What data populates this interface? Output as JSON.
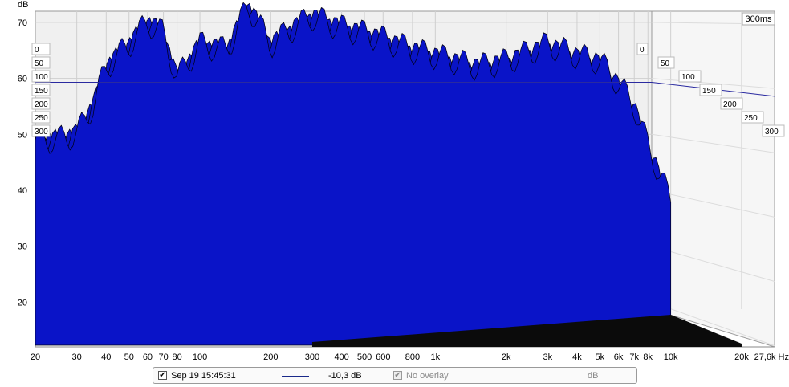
{
  "chart_data": {
    "type": "area",
    "chart_kind": "cumulative spectral decay (waterfall)",
    "ylabel": "dB",
    "xunit": "Hz",
    "yticks": [
      "70",
      "60",
      "50",
      "40",
      "30",
      "20"
    ],
    "xticks": [
      {
        "f": 20,
        "label": "20"
      },
      {
        "f": 30,
        "label": "30"
      },
      {
        "f": 40,
        "label": "40"
      },
      {
        "f": 50,
        "label": "50"
      },
      {
        "f": 60,
        "label": "60"
      },
      {
        "f": 70,
        "label": "70"
      },
      {
        "f": 80,
        "label": "80"
      },
      {
        "f": 100,
        "label": "100"
      },
      {
        "f": 200,
        "label": "200"
      },
      {
        "f": 300,
        "label": "300"
      },
      {
        "f": 400,
        "label": "400"
      },
      {
        "f": 500,
        "label": "500"
      },
      {
        "f": 600,
        "label": "600"
      },
      {
        "f": 800,
        "label": "800"
      },
      {
        "f": 1000,
        "label": "1k"
      },
      {
        "f": 2000,
        "label": "2k"
      },
      {
        "f": 3000,
        "label": "3k"
      },
      {
        "f": 4000,
        "label": "4k"
      },
      {
        "f": 5000,
        "label": "5k"
      },
      {
        "f": 6000,
        "label": "6k"
      },
      {
        "f": 7000,
        "label": "7k"
      },
      {
        "f": 8000,
        "label": "8k"
      },
      {
        "f": 10000,
        "label": "10k"
      },
      {
        "f": 20000,
        "label": "20k"
      },
      {
        "f": 27600,
        "label": "27,6k Hz"
      }
    ],
    "xscale": "log",
    "xlim": [
      20,
      27600
    ],
    "ylim": [
      12,
      72
    ],
    "time_axis_label": "300ms",
    "time_ticks": [
      "0",
      "50",
      "100",
      "150",
      "200",
      "250",
      "300"
    ],
    "time_range_ms": [
      0,
      300
    ],
    "series": [
      {
        "color": "#0a14c8",
        "frequency_hz": [
          20,
          25,
          30,
          35,
          40,
          50,
          60,
          70,
          80,
          100,
          130,
          160,
          200,
          250,
          300,
          400,
          500,
          600,
          800,
          1000,
          1500,
          2000,
          3000,
          4000,
          5000,
          6000,
          7000,
          8000,
          10000
        ],
        "level_db": [
          49,
          49,
          50,
          55,
          62,
          66,
          70,
          68,
          60,
          66,
          65,
          73,
          66,
          69,
          71,
          69,
          68,
          67,
          65,
          64,
          62,
          63,
          66,
          64,
          63,
          59,
          55,
          48,
          38
        ]
      }
    ]
  },
  "legend": {
    "checkbox_mark": "✔",
    "measurement_label": "Sep 19 15:45:31",
    "line_color": "#1a2a8a",
    "value": "-10,3 dB",
    "overlay_checkbox_mark": "✔",
    "overlay_label": "No overlay",
    "unit": "dB"
  }
}
